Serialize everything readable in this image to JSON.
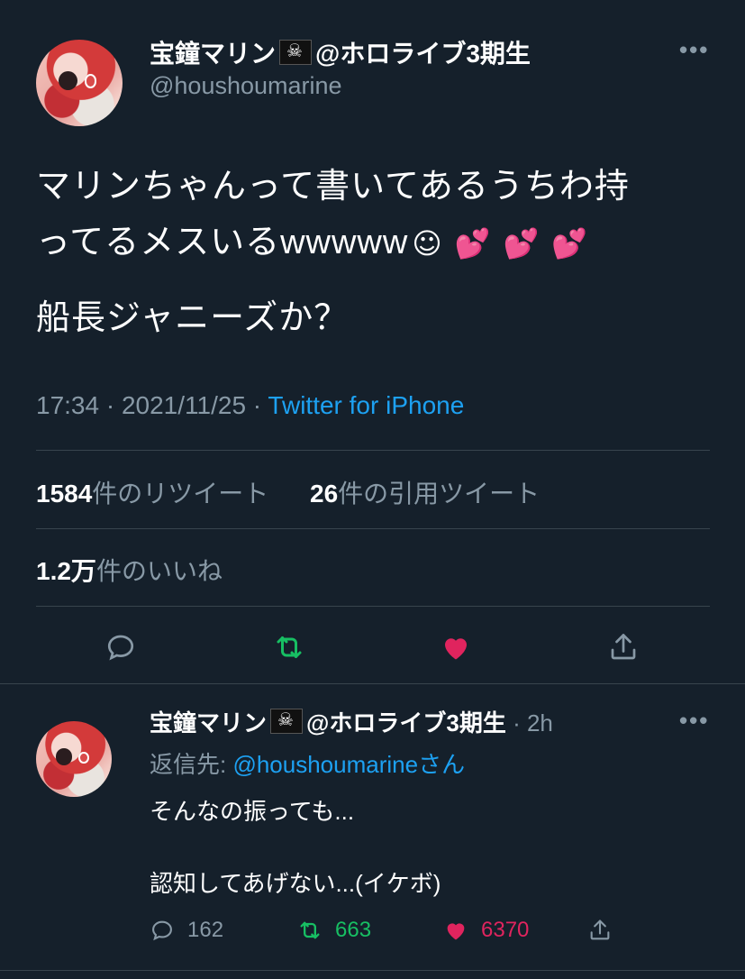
{
  "main_tweet": {
    "display_name": "宝鐘マリン",
    "name_suffix": "@ホロライブ3期生",
    "flag_icon": "pirate-flag-icon",
    "handle": "@houshoumarine",
    "text_line1": "マリンちゃんって書いてあるうちわ持",
    "text_line2": "ってるメスいるwwwww",
    "text_emojis": "☺💕💕💕",
    "text_line3": "船長ジャニーズか？",
    "time": "17:34",
    "date": "2021/11/25",
    "source": "Twitter for iPhone",
    "retweets_count": "1584",
    "retweets_label": "件のリツイート",
    "quotes_count": "26",
    "quotes_label": "件の引用ツイート",
    "likes_count": "1.2万",
    "likes_label": "件のいいね"
  },
  "reply": {
    "display_name": "宝鐘マリン",
    "name_suffix": "@ホロライブ3期生",
    "age": "2h",
    "reply_to_prefix": "返信先: ",
    "reply_to_mention": "@houshoumarine",
    "reply_to_suffix": "さん",
    "text_line1": "そんなの振っても...",
    "text_line2": "認知してあげない...(イケボ)",
    "replies": "162",
    "retweets": "663",
    "likes": "6370"
  },
  "colors": {
    "background": "#15202b",
    "secondary_text": "#8899a6",
    "link": "#1da1f2",
    "retweet": "#17bf63",
    "like": "#e0245e"
  }
}
